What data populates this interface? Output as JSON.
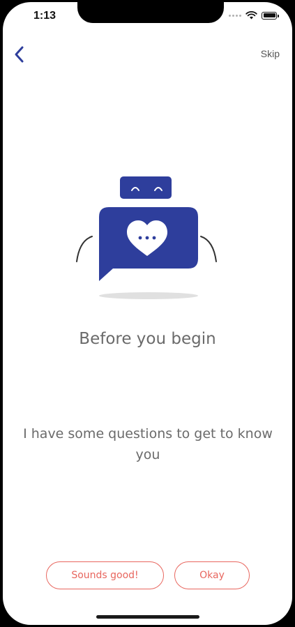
{
  "status_bar": {
    "time": "1:13"
  },
  "nav": {
    "back_icon": "chevron-left-icon",
    "skip_label": "Skip"
  },
  "illustration": {
    "icon": "robot-chat-bubble-heart",
    "accent_color": "#2e3e9c"
  },
  "content": {
    "title": "Before you begin",
    "message": "I have some questions to get to know you"
  },
  "actions": {
    "sounds_good_label": "Sounds good!",
    "okay_label": "Okay",
    "button_color": "#e8665e"
  }
}
